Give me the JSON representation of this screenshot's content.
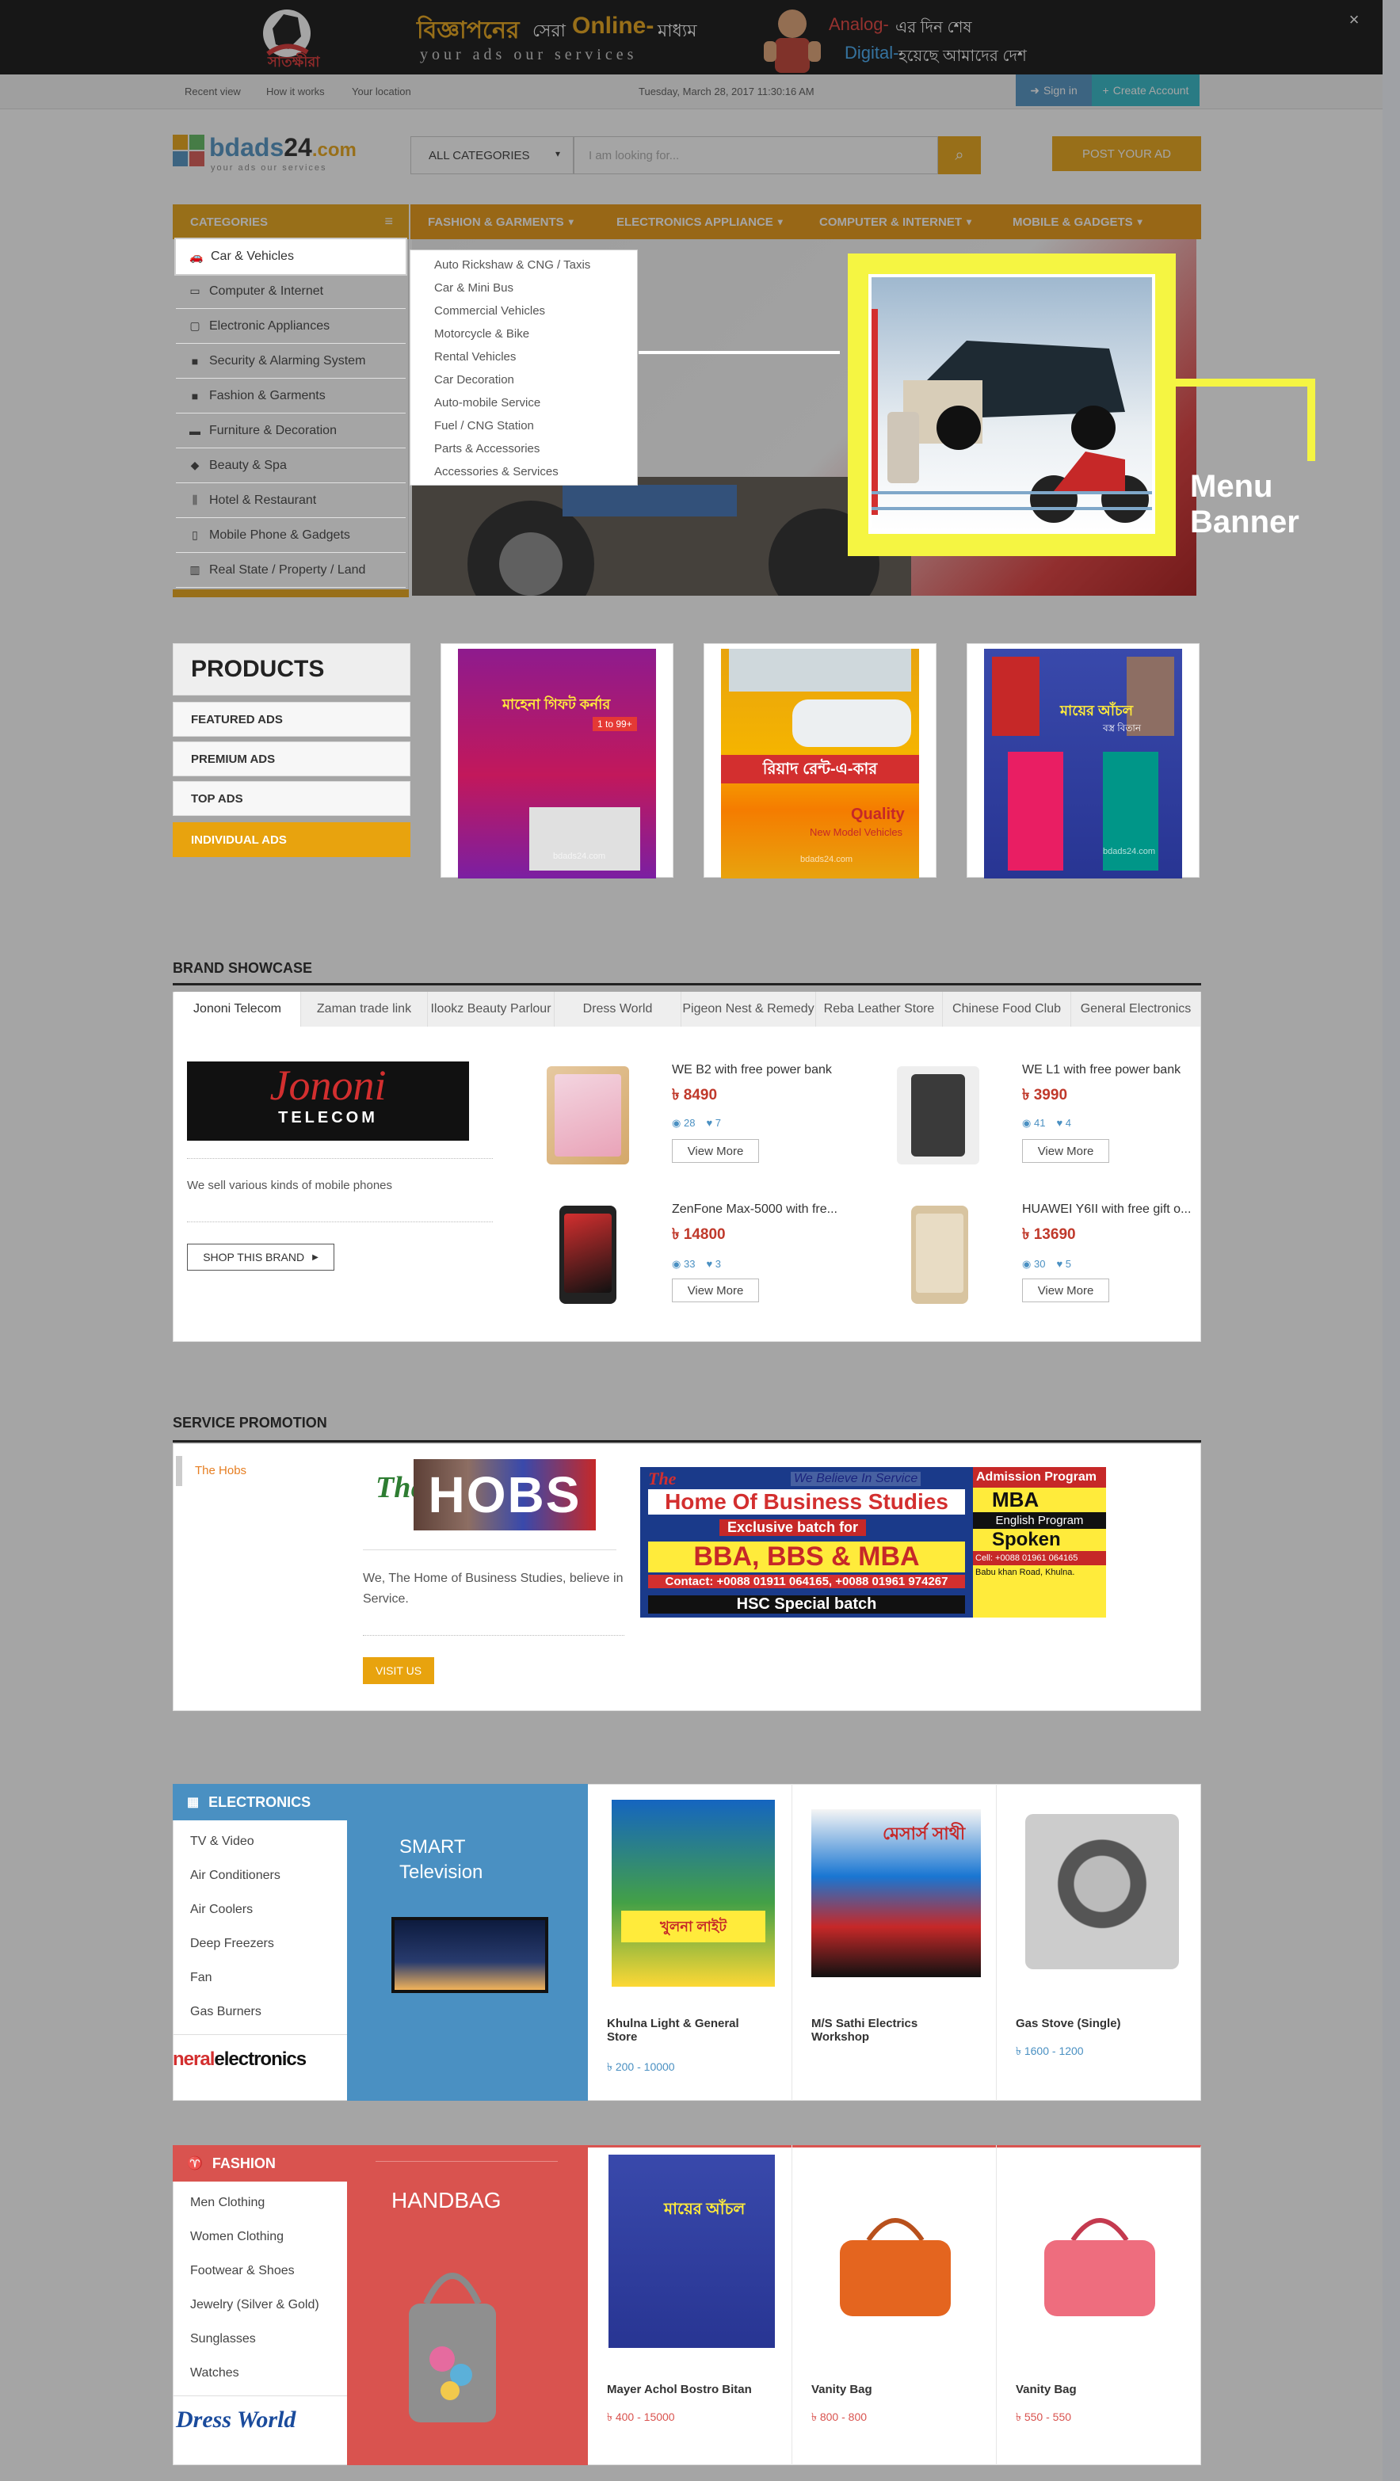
{
  "topbar": {
    "logo_text": "সাতক্ষীরা",
    "slogan_bn_1": "বিজ্ঞাপনের",
    "slogan_bn_2": "সেরা",
    "slogan_online": "Online-",
    "slogan_bn_3": "মাধ্যম",
    "slogan_en": "your ads our services",
    "analog": "Analog-",
    "analog_bn": "এর দিন শেষ",
    "digital": "Digital-",
    "digital_bn": "হয়েছে আমাদের দেশ",
    "close": "×"
  },
  "utilbar": {
    "links": [
      "Recent view",
      "How it works",
      "Your location"
    ],
    "datetime": "Tuesday, March 28, 2017 11:30:16 AM",
    "signin": "Sign in",
    "create_account": "Create Account"
  },
  "header": {
    "logo_text": "bdads",
    "logo_num": "24",
    "logo_com": ".com",
    "logo_tag": "your ads our services",
    "category_select": "ALL CATEGORIES",
    "search_placeholder": "I am looking for...",
    "post_ad": "POST YOUR AD"
  },
  "nav": {
    "categories_label": "CATEGORIES",
    "items": [
      "FASHION & GARMENTS",
      "ELECTRONICS APPLIANCE",
      "COMPUTER & INTERNET",
      "MOBILE & GADGETS"
    ]
  },
  "categories": [
    {
      "label": "Car & Vehicles",
      "icon": "car-icon"
    },
    {
      "label": "Computer & Internet",
      "icon": "laptop-icon"
    },
    {
      "label": "Electronic Appliances",
      "icon": "monitor-icon"
    },
    {
      "label": "Security & Alarming System",
      "icon": "lock-icon"
    },
    {
      "label": "Fashion & Garments",
      "icon": "bag-icon"
    },
    {
      "label": "Furniture & Decoration",
      "icon": "bed-icon"
    },
    {
      "label": "Beauty & Spa",
      "icon": "diamond-icon"
    },
    {
      "label": "Hotel & Restaurant",
      "icon": "cutlery-icon"
    },
    {
      "label": "Mobile Phone & Gadgets",
      "icon": "mobile-icon"
    },
    {
      "label": "Real State / Property / Land",
      "icon": "building-icon"
    }
  ],
  "submenu": [
    "Auto Rickshaw & CNG / Taxis",
    "Car & Mini Bus",
    "Commercial Vehicles",
    "Motorcycle & Bike",
    "Rental Vehicles",
    "Car Decoration",
    "Auto-mobile Service",
    "Fuel / CNG Station",
    "Parts & Accessories",
    "Accessories & Services"
  ],
  "annotation": {
    "menu_banner": "Menu Banner"
  },
  "products": {
    "title": "PRODUCTS",
    "buttons": [
      "FEATURED ADS",
      "PREMIUM ADS",
      "TOP ADS",
      "INDIVIDUAL ADS"
    ],
    "ad1": {
      "title": "মাহেনা গিফট কর্নার",
      "sub": "1 to 99+",
      "watermark": "bdads24.com"
    },
    "ad2": {
      "title": "রিয়াদ রেন্ট-এ-কার",
      "quality": "Quality",
      "newmodel": "New Model Vehicles",
      "watermark": "bdads24.com"
    },
    "ad3": {
      "title": "মায়ের আঁচল",
      "sub": "বস্ত্র বিতান",
      "watermark": "bdads24.com"
    }
  },
  "brand": {
    "title": "BRAND SHOWCASE",
    "tabs": [
      "Jononi Telecom",
      "Zaman trade link",
      "Ilookz Beauty Parlour",
      "Dress World",
      "Pigeon Nest & Remedy",
      "Reba Leather Store",
      "Chinese Food Club",
      "General Electronics"
    ],
    "logo_main": "Jononi",
    "logo_sub": "TELECOM",
    "description": "We sell various kinds of mobile phones",
    "shop_button": "SHOP THIS BRAND",
    "products": [
      {
        "name": "WE B2 with free power bank",
        "price": "৳ 8490",
        "views": "28",
        "likes": "7",
        "button": "View More"
      },
      {
        "name": "WE L1 with free power bank",
        "price": "৳ 3990",
        "views": "41",
        "likes": "4",
        "button": "View More"
      },
      {
        "name": "ZenFone Max-5000 with fre...",
        "price": "৳ 14800",
        "views": "33",
        "likes": "3",
        "button": "View More"
      },
      {
        "name": "HUAWEI Y6II with free gift o...",
        "price": "৳ 13690",
        "views": "30",
        "likes": "5",
        "button": "View More"
      }
    ]
  },
  "service": {
    "title": "SERVICE PROMOTION",
    "tab": "The Hobs",
    "logo_the": "The",
    "logo_main": "HOBS",
    "description": "We, The Home of Business Studies, believe in Service.",
    "visit_button": "VISIT US",
    "banner": {
      "line1": "The",
      "line2": "We Believe In Service",
      "line3": "Home Of Business Studies",
      "line4": "Exclusive batch for",
      "line5": "BBA, BBS & MBA",
      "line6": "Contact: +0088 01911 064165, +0088 01961 974267",
      "line7": "HSC Special batch",
      "side1": "Admission Program",
      "side2": "MBA",
      "side3": "English Program",
      "side4": "Spoken",
      "side5": "Cell: +0088 01961 064165",
      "side6": "Babu khan Road, Khulna."
    }
  },
  "electronics": {
    "title": "ELECTRONICS",
    "items": [
      "TV & Video",
      "Air Conditioners",
      "Air Coolers",
      "Deep Freezers",
      "Fan",
      "Gas Burners"
    ],
    "brand_logo_1": "neral",
    "brand_logo_2": "electronics",
    "promo_title": "SMART\nTelevision",
    "cards": [
      {
        "name": "Khulna Light & General Store",
        "price": "৳ 200 - 10000",
        "img_text": "খুলনা লাইট"
      },
      {
        "name": "M/S Sathi Electrics Workshop",
        "price": "",
        "img_text": "মেসার্স সাথী"
      },
      {
        "name": "Gas Stove (Single)",
        "price": "৳ 1600 - 1200"
      }
    ]
  },
  "fashion": {
    "title": "FASHION",
    "items": [
      "Men Clothing",
      "Women Clothing",
      "Footwear & Shoes",
      "Jewelry (Silver & Gold)",
      "Sunglasses",
      "Watches"
    ],
    "brand_logo": "Dress World",
    "promo_title": "HANDBAG",
    "cards": [
      {
        "name": "Mayer Achol Bostro Bitan",
        "price": "৳ 400 - 15000",
        "img_text": "মায়ের আঁচল"
      },
      {
        "name": "Vanity Bag",
        "price": "৳ 800 - 800"
      },
      {
        "name": "Vanity Bag",
        "price": "৳ 550 - 550"
      }
    ]
  },
  "colors": {
    "accent": "#e8a30e",
    "dark": "#0b0b0b",
    "blue": "#4a90c2",
    "red": "#d9534f",
    "highlight": "#f5f542"
  }
}
